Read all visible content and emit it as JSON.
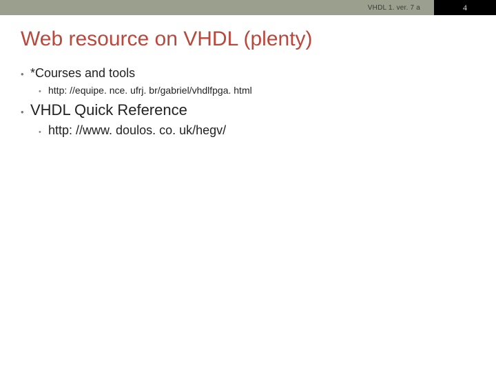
{
  "header": {
    "left_text": "VHDL 1. ver. 7 a",
    "page_number": "4"
  },
  "title": "Web resource on VHDL (plenty)",
  "bullets": [
    {
      "text": "*Courses and tools",
      "size": "normal",
      "children": [
        {
          "text": "http: //equipe. nce. ufrj. br/gabriel/vhdlfpga. html",
          "size": "normal"
        }
      ]
    },
    {
      "text": "VHDL Quick Reference",
      "size": "big",
      "children": [
        {
          "text": "http: //www. doulos. co. uk/hegv/",
          "size": "big"
        }
      ]
    }
  ]
}
